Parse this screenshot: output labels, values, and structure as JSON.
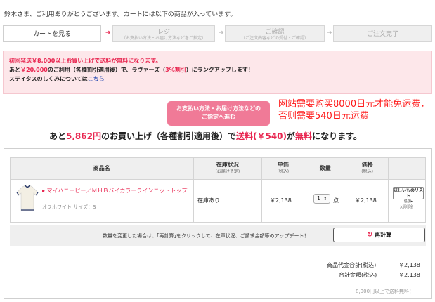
{
  "greeting": "鈴木さま、ご利用ありがとうございます。カートには以下の商品が入っています。",
  "steps": [
    {
      "title": "カートを見る",
      "sub": ""
    },
    {
      "title": "レジ",
      "sub": "（お支払い方法・お届け方法などをご指定）"
    },
    {
      "title": "ご確認",
      "sub": "（ご注文内容などの受付・ご確認）"
    },
    {
      "title": "ご注文完了",
      "sub": ""
    }
  ],
  "notice": {
    "line1": "初回発送￥8,000以上お買い上げで送料が無料になります。",
    "line2_a": "あと",
    "line2_amount": "￥20,000",
    "line2_b": "のご利用（各種割引適用後）で、ラヴァーズ（",
    "line2_rate": "3%割引",
    "line2_c": "）にランクアップします！",
    "line3_a": "ステイタスのしくみについては",
    "line3_link": "こちら"
  },
  "proceed_button": {
    "line1": "お支払い方法・お届け方法などの",
    "line2": "ご指定へ進む"
  },
  "annotation": {
    "line1": "网站需要购买8000日元才能免运费，",
    "line2": "否则需要540日元运费"
  },
  "remain": {
    "a": "あと",
    "amount": "5,862円",
    "b": "のお買い上げ（各種割引適用後）で",
    "shipping": "送料(￥540)",
    "c": "が",
    "free": "無料",
    "d": "になります。"
  },
  "table": {
    "headers": {
      "product": "商品名",
      "stock": "在庫状況",
      "stock_sub": "(お届け予定)",
      "unit_price": "単価",
      "unit_price_sub": "(税込)",
      "qty": "数量",
      "price": "価格",
      "price_sub": "(税込)"
    },
    "item": {
      "name": "▸ マイハニーピー／ＭＨＢバイカラーラインニットトップ",
      "variant": "オフホワイト サイズ：S",
      "stock": "在庫あり",
      "unit_price": "￥2,138",
      "qty": "1",
      "qty_unit": "点",
      "price": "￥2,138",
      "wishlist_a": "ほしいものリスト",
      "wishlist_b": "追加▸",
      "delete": "×削除"
    }
  },
  "recalc": {
    "message": "数量を変更した場合は、｢再計算｣をクリックして、在庫状況、ご請求金額等のアップデート！",
    "button": "再計算"
  },
  "summary": {
    "subtotal_label": "商品代金合計(税込)",
    "subtotal": "￥2,138",
    "total_label": "合計金額(税込)",
    "total": "￥2,138"
  },
  "free_shipping_note": "8,000円以上で送料無料！",
  "colors": {
    "accent": "#e8254f",
    "button_pink": "#f07a97",
    "notice_bg": "#fde7ea"
  }
}
